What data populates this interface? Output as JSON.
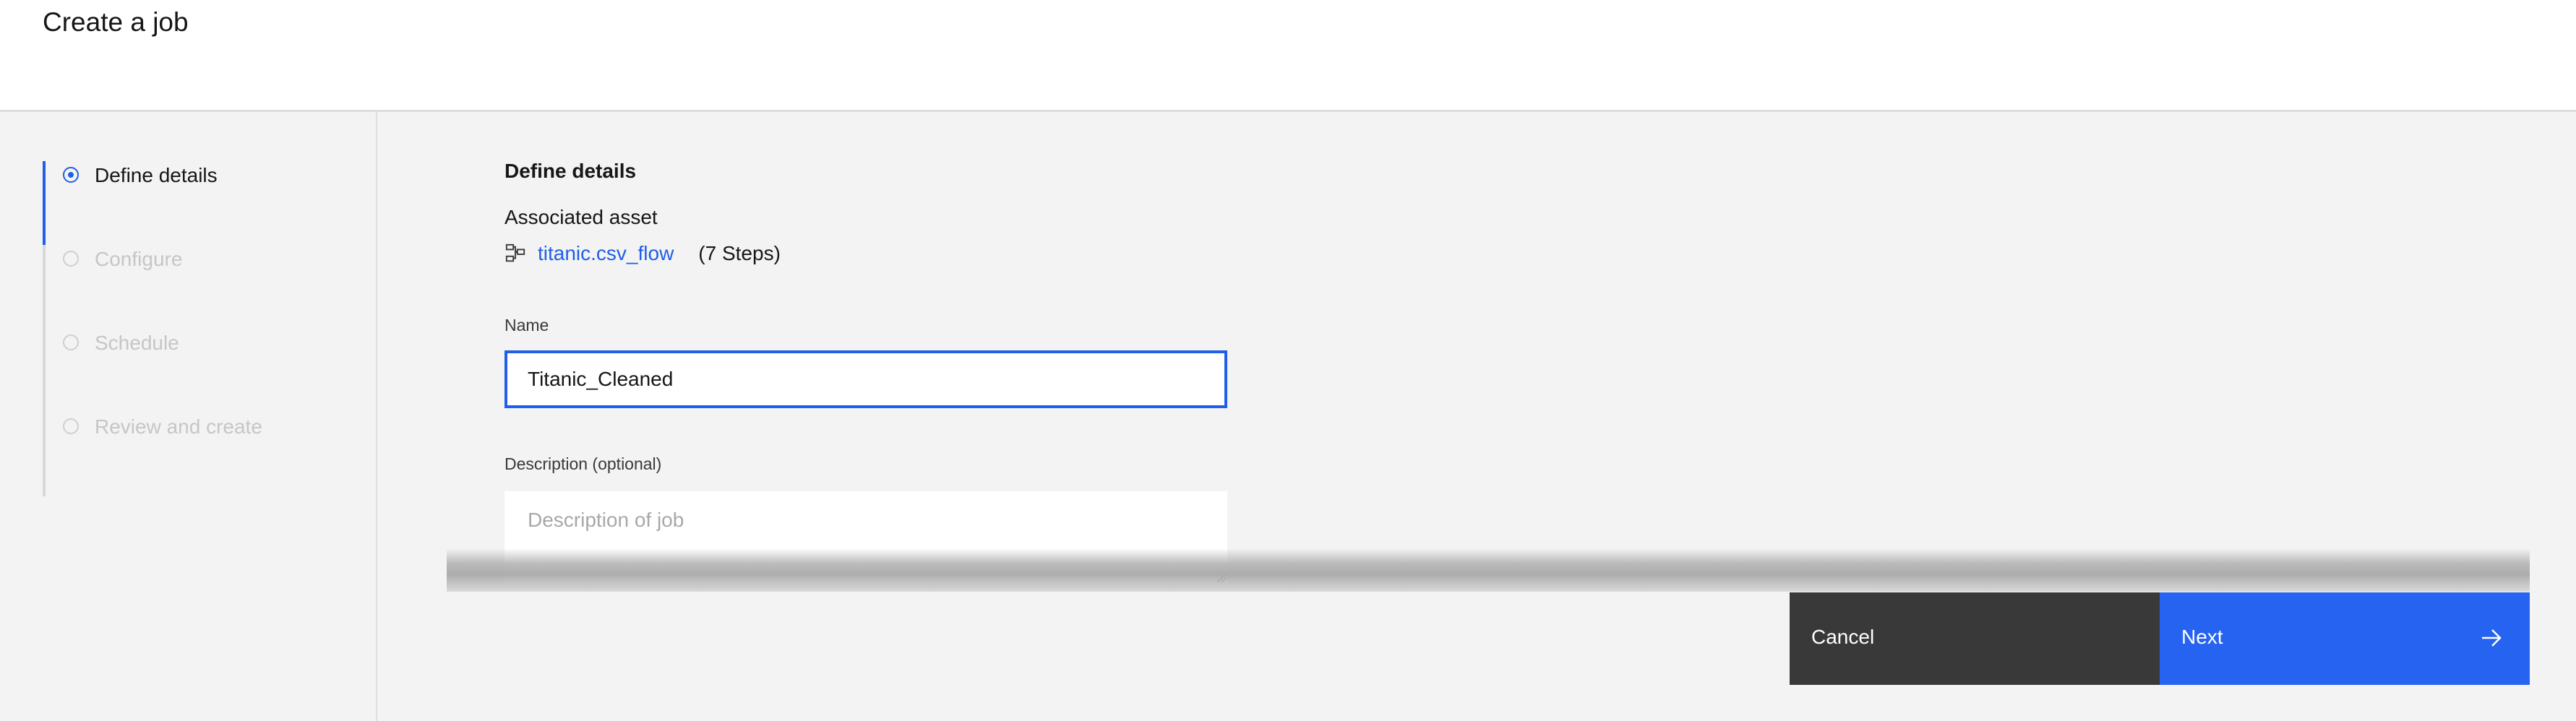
{
  "header": {
    "title": "Create a job"
  },
  "sidebar": {
    "steps": [
      {
        "label": "Define details",
        "state": "active"
      },
      {
        "label": "Configure",
        "state": "inactive"
      },
      {
        "label": "Schedule",
        "state": "inactive"
      },
      {
        "label": "Review and create",
        "state": "inactive"
      }
    ]
  },
  "main": {
    "section_title": "Define details",
    "associated_asset_label": "Associated asset",
    "asset_icon": "data-flow-icon",
    "asset_name": "titanic.csv_flow",
    "asset_steps": "(7 Steps)",
    "name_label": "Name",
    "name_value": "Titanic_Cleaned",
    "description_label": "Description (optional)",
    "description_placeholder": "Description of job"
  },
  "footer": {
    "cancel_label": "Cancel",
    "next_label": "Next",
    "next_icon": "arrow-right-icon"
  },
  "colors": {
    "accent": "#1f5ee8",
    "primary_button": "#2563f0",
    "secondary_button": "#393939",
    "background": "#f3f3f3"
  }
}
